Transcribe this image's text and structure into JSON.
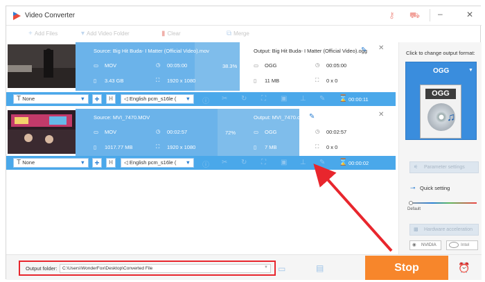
{
  "app": {
    "title": "Video Converter"
  },
  "toolbar": {
    "add_files": "Add Files",
    "add_video_folder": "Add Video Folder",
    "clear": "Clear",
    "merge": "Merge"
  },
  "tasks": [
    {
      "source": "Source: Big Hit Buda- I Matter (Official Video).mov",
      "src_format": "MOV",
      "src_duration": "00:05:00",
      "src_size": "3.43 GB",
      "src_resolution": "1920 x 1080",
      "progress": "38.3%",
      "progress_value": 0.383,
      "output": "Output: Big Hit Buda- I Matter (Official Video).ogg",
      "out_format": "OGG",
      "out_duration": "00:05:00",
      "out_size": "11 MB",
      "out_resolution": "0 x 0",
      "subtitle": "None",
      "audio": "English pcm_s16le (",
      "time": "00:00:11"
    },
    {
      "source": "Source: MVI_7470.MOV",
      "src_format": "MOV",
      "src_duration": "00:02:57",
      "src_size": "1017.77 MB",
      "src_resolution": "1920 x 1080",
      "progress": "72%",
      "progress_value": 0.72,
      "output": "Output: MVI_7470.ogg",
      "out_format": "OGG",
      "out_duration": "00:02:57",
      "out_size": "7 MB",
      "out_resolution": "0 x 0",
      "subtitle": "None",
      "audio": "English pcm_s16le (",
      "time": "00:00:02"
    }
  ],
  "right": {
    "change_format_label": "Click to change output format:",
    "format": "OGG",
    "format_icon_text": "OGG",
    "parameter_settings": "Parameter settings",
    "quick_setting": "Quick setting",
    "default": "Default",
    "hw_accel": "Hardware acceleration",
    "nvidia": "NVIDIA",
    "intel": "Intel"
  },
  "bottom": {
    "output_folder_label": "Output folder:",
    "output_folder_path": "C:\\Users\\WonderFox\\Desktop\\Converted File",
    "stop": "Stop"
  },
  "colors": {
    "selection": "#6bb3ea",
    "row_bar": "#4aa8ea",
    "stop": "#f7862b",
    "annotation": "#e8262d"
  }
}
